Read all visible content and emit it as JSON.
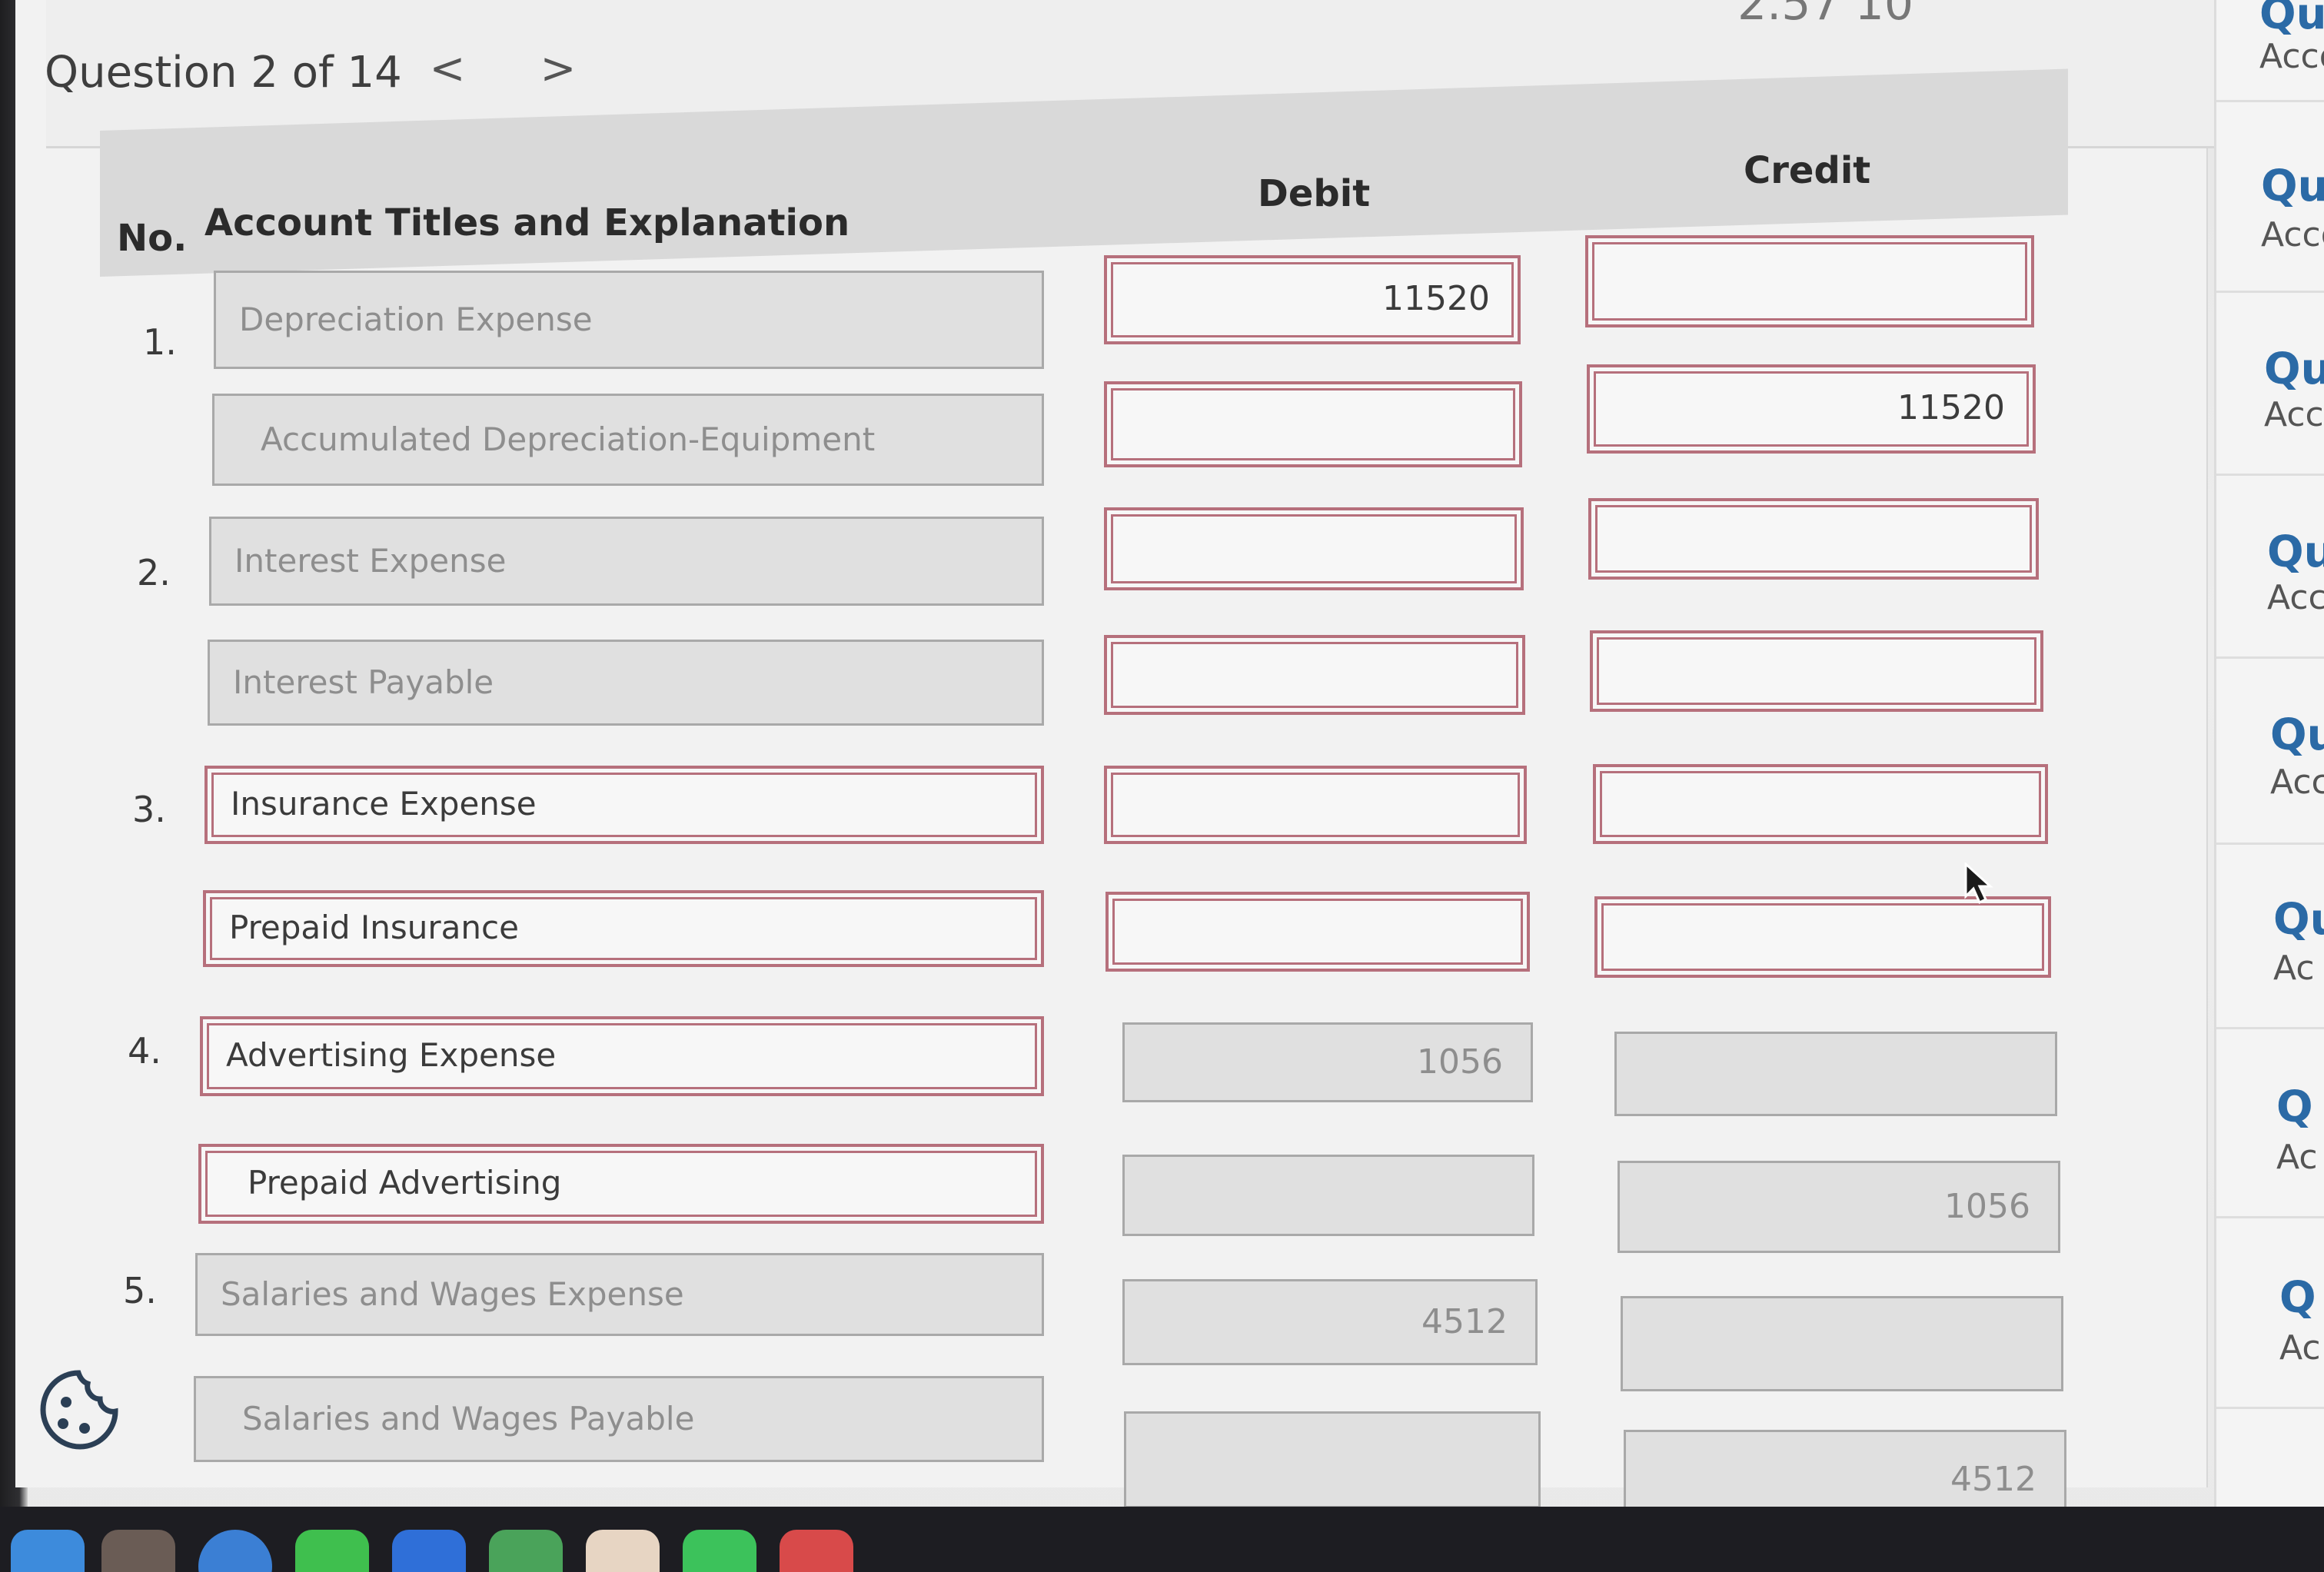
{
  "header": {
    "question_label": "Question 2 of 14",
    "prev_glyph": "<",
    "next_glyph": ">",
    "score_fragment": "2.57 10"
  },
  "table": {
    "col_no": "No.",
    "col_account": "Account Titles and Explanation",
    "col_debit": "Debit",
    "col_credit": "Credit"
  },
  "entries": [
    {
      "no": "1.",
      "account": "Depreciation Expense",
      "debit": "11520",
      "credit": ""
    },
    {
      "no": "",
      "account": "Accumulated Depreciation-Equipment",
      "debit": "",
      "credit": "11520"
    },
    {
      "no": "2.",
      "account": "Interest Expense",
      "debit": "",
      "credit": ""
    },
    {
      "no": "",
      "account": "Interest Payable",
      "debit": "",
      "credit": ""
    },
    {
      "no": "3.",
      "account": "Insurance Expense",
      "debit": "",
      "credit": ""
    },
    {
      "no": "",
      "account": "Prepaid Insurance",
      "debit": "",
      "credit": ""
    },
    {
      "no": "4.",
      "account": "Advertising Expense",
      "debit": "1056",
      "credit": ""
    },
    {
      "no": "",
      "account": "Prepaid Advertising",
      "debit": "",
      "credit": "1056"
    },
    {
      "no": "5.",
      "account": "Salaries and Wages Expense",
      "debit": "4512",
      "credit": ""
    },
    {
      "no": "",
      "account": "Salaries and Wages Payable",
      "debit": "",
      "credit": "4512"
    }
  ],
  "sidebar": {
    "items": [
      {
        "title": "Que",
        "sub": "Acco"
      },
      {
        "title": "Qu",
        "sub": "Acco"
      },
      {
        "title": "Qu",
        "sub": "Acco"
      },
      {
        "title": "Qu",
        "sub": "Acc"
      },
      {
        "title": "Qu",
        "sub": "Acc"
      },
      {
        "title": "Qu",
        "sub": "Ac"
      },
      {
        "title": "Q",
        "sub": "Ac"
      },
      {
        "title": "Q",
        "sub": "Ac"
      }
    ]
  },
  "colors": {
    "active_border": "#b6707c",
    "locked_fill": "#e0e0e0",
    "sidebar_title": "#2b6aa6"
  },
  "icons": [
    "chevron-left-icon",
    "chevron-right-icon",
    "cookie-icon",
    "mouse-cursor-icon"
  ]
}
